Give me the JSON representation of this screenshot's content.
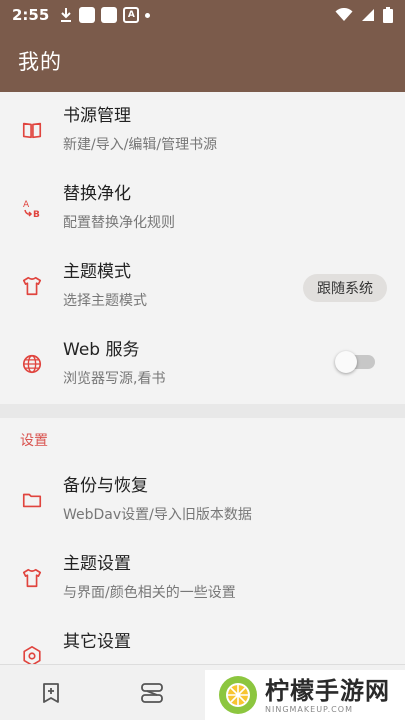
{
  "status_bar": {
    "time": "2:55",
    "notif_letter": "A"
  },
  "app_bar": {
    "title": "我的"
  },
  "items_top": [
    {
      "title": "书源管理",
      "subtitle": "新建/导入/编辑/管理书源",
      "icon": "book-icon"
    },
    {
      "title": "替换净化",
      "subtitle": "配置替换净化规则",
      "icon": "replace-icon"
    },
    {
      "title": "主题模式",
      "subtitle": "选择主题模式",
      "icon": "shirt-icon",
      "pill": "跟随系统"
    },
    {
      "title": "Web 服务",
      "subtitle": "浏览器写源,看书",
      "icon": "globe-icon",
      "toggle_on": false
    }
  ],
  "settings": {
    "header": "设置",
    "items": [
      {
        "title": "备份与恢复",
        "subtitle": "WebDav设置/导入旧版本数据",
        "icon": "folder-icon"
      },
      {
        "title": "主题设置",
        "subtitle": "与界面/颜色相关的一些设置",
        "icon": "shirt-icon"
      },
      {
        "title": "其它设置",
        "subtitle": "",
        "icon": "settings-icon"
      }
    ]
  },
  "watermark": {
    "title": "柠檬手游网",
    "url": "NINGMAKEUP.COM"
  },
  "colors": {
    "primary": "#7b5b4b",
    "accent": "#e0443e"
  }
}
